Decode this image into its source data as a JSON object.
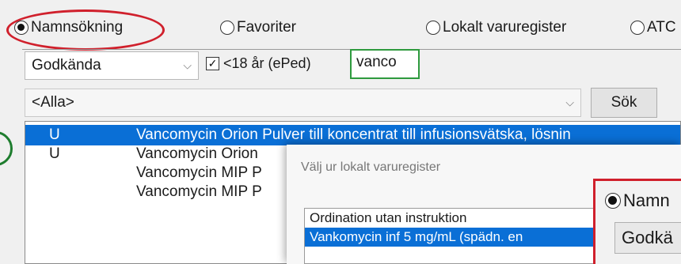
{
  "search_modes": {
    "name_search": "Namnsökning",
    "favorites": "Favoriter",
    "local_register": "Lokalt varuregister",
    "atc": "ATC"
  },
  "filters": {
    "approval_value": "Godkända",
    "under18_label": "<18 år (ePed)",
    "under18_checked": true,
    "search_value": "vanco",
    "category_value": "<Alla>",
    "search_button": "Sök"
  },
  "results": [
    {
      "code": "U",
      "name": "Vancomycin Orion Pulver till koncentrat till infusionsvätska, lösnin"
    },
    {
      "code": "U",
      "name": "Vancomycin Orion"
    },
    {
      "code": "",
      "name": "Vancomycin MIP P"
    },
    {
      "code": "",
      "name": "Vancomycin MIP P"
    }
  ],
  "dialog": {
    "title": "Välj ur lokalt varuregister",
    "items": [
      "Ordination utan instruktion",
      "Vankomycin inf 5 mg/mL (spädn. en"
    ]
  },
  "panel": {
    "radio_label": "Namn",
    "combo_value": "Godkä"
  },
  "colors": {
    "highlight_red": "#d0202c",
    "highlight_green": "#2e9a3e",
    "selection_blue": "#0a6fd6"
  }
}
